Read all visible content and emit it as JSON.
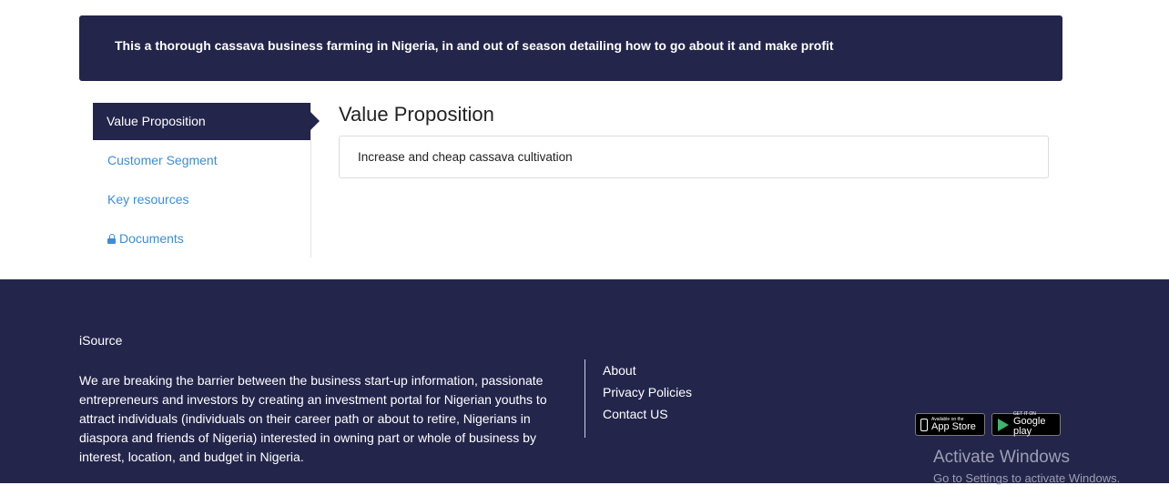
{
  "banner": {
    "text": "This a thorough cassava business farming in Nigeria, in and out of season detailing how to go about it and make profit"
  },
  "sidebar": {
    "items": [
      {
        "label": "Value Proposition",
        "active": true
      },
      {
        "label": "Customer Segment",
        "active": false
      },
      {
        "label": "Key resources",
        "active": false
      },
      {
        "label": "Documents",
        "active": false,
        "icon": "lock-icon"
      }
    ]
  },
  "content": {
    "title": "Value Proposition",
    "text": "Increase and cheap cassava cultivation"
  },
  "footer": {
    "brand": "iSource",
    "description": "We are breaking the barrier between the business start-up information, passionate entrepreneurs and investors by creating an investment portal for Nigerian youths to attract individuals (individuals on their career path or about to retire, Nigerians in diaspora and friends of Nigeria) interested in owning part or whole of business by interest, location, and budget in Nigeria.",
    "links": [
      "About",
      "Privacy Policies",
      "Contact US"
    ],
    "badges": {
      "appstore_small": "Available on the",
      "appstore_big": "App Store",
      "google_small": "GET IT ON",
      "google_big": "Google play"
    }
  },
  "watermark": {
    "line1": "Activate Windows",
    "line2": "Go to Settings to activate Windows."
  },
  "colors": {
    "navy": "#23254b",
    "link_blue": "#3b8ddb"
  }
}
